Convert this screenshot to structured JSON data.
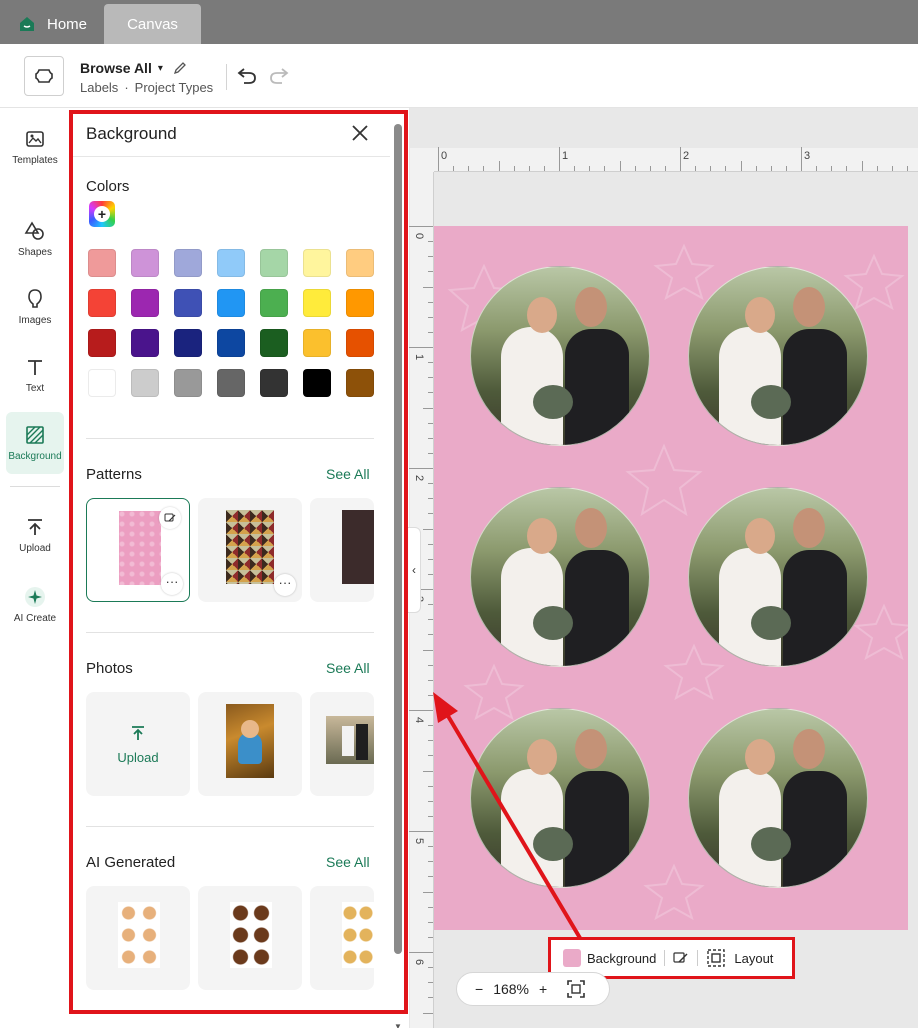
{
  "tabs": [
    {
      "label": "Home",
      "icon": "house-icon"
    },
    {
      "label": "Canvas",
      "icon": ""
    }
  ],
  "toolbar": {
    "title": "Browse All",
    "crumb_1": "Labels",
    "crumb_sep": "·",
    "crumb_2": "Project Types"
  },
  "rail": {
    "items": [
      {
        "label": "Templates",
        "icon": "templates-icon"
      },
      {
        "label": "Shapes",
        "icon": "shapes-icon"
      },
      {
        "label": "Images",
        "icon": "images-icon"
      },
      {
        "label": "Text",
        "icon": "text-icon"
      },
      {
        "label": "Background",
        "icon": "background-icon"
      },
      {
        "label": "Upload",
        "icon": "upload-icon"
      },
      {
        "label": "AI Create",
        "icon": "sparkle-icon"
      }
    ]
  },
  "panel": {
    "title": "Background",
    "colors_title": "Colors",
    "patterns_title": "Patterns",
    "photos_title": "Photos",
    "ai_title": "AI Generated",
    "see_all": "See All",
    "upload_label": "Upload",
    "more_label": "···"
  },
  "swatch_colors": [
    [
      "#ef9a9a",
      "#ce93d8",
      "#9fa8da",
      "#90caf9",
      "#a5d6a7",
      "#fff59d",
      "#ffcc80"
    ],
    [
      "#f44336",
      "#9c27b0",
      "#3f51b5",
      "#2196f3",
      "#4caf50",
      "#ffeb3b",
      "#ff9800"
    ],
    [
      "#b71c1c",
      "#4a148c",
      "#1a237e",
      "#0d47a1",
      "#1b5e20",
      "#fbc02d",
      "#e65100"
    ],
    [
      "#ffffff",
      "#cccccc",
      "#999999",
      "#666666",
      "#333333",
      "#000000",
      "#8d5109"
    ]
  ],
  "ruler": {
    "top_labels": [
      "0",
      "1",
      "2",
      "3"
    ],
    "left_labels": [
      "0",
      "1",
      "2",
      "3",
      "4",
      "5",
      "6"
    ]
  },
  "context_bar": {
    "background_label": "Background",
    "layout_label": "Layout",
    "swatch_color": "#eaaac8"
  },
  "zoom": {
    "minus": "−",
    "value": "168%",
    "plus": "+"
  },
  "colors": {
    "accent": "#1b7a57",
    "highlight": "#e0141a",
    "artboard": "#eaaac8"
  }
}
